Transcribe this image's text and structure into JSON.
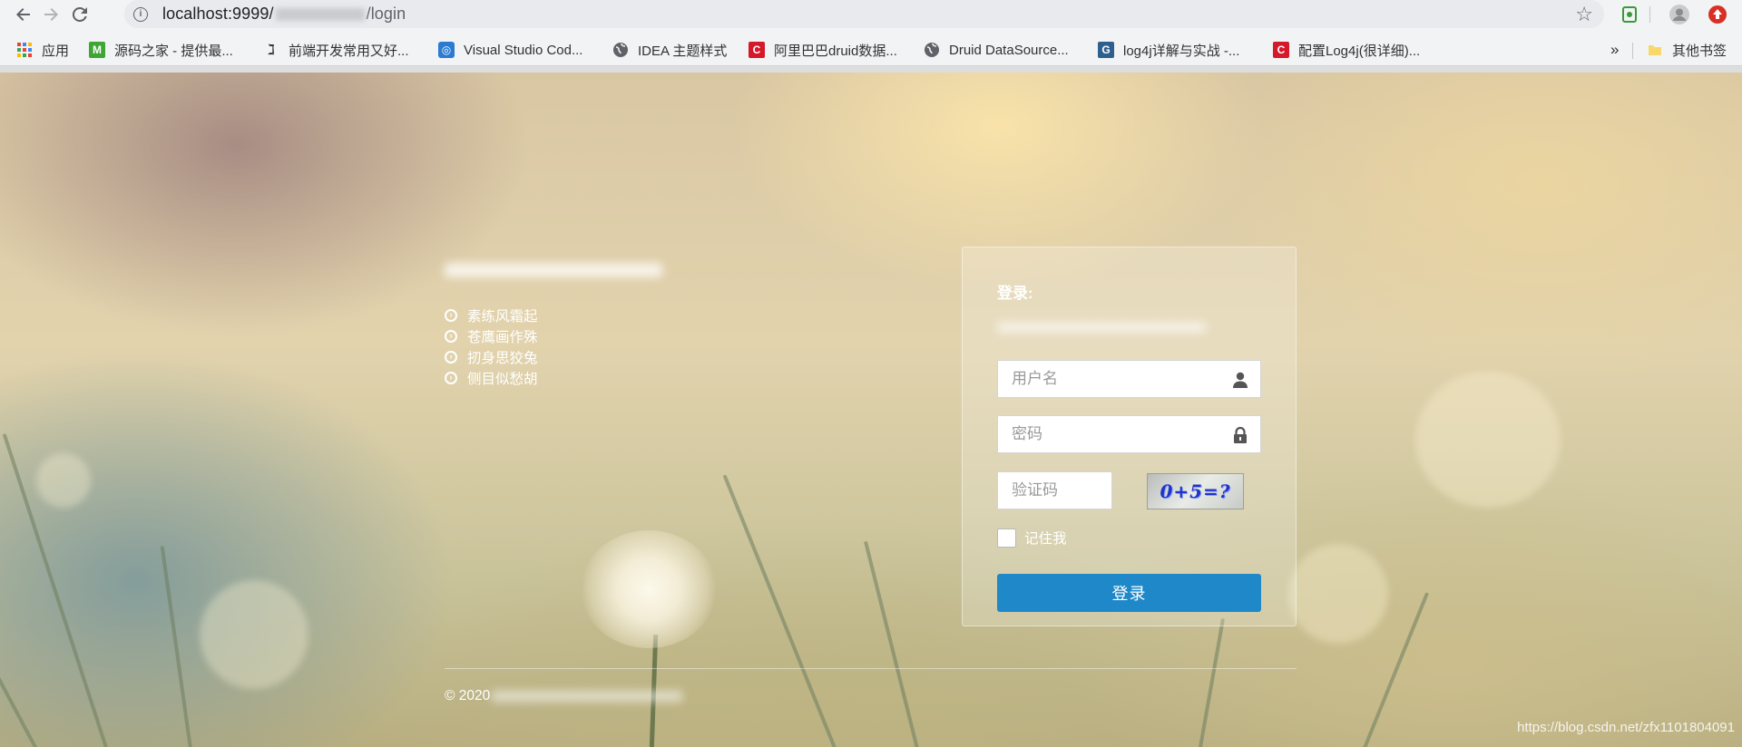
{
  "browser": {
    "url_host": "localhost:9999/",
    "url_path": "/login",
    "bookmarks": [
      {
        "label": "应用",
        "icon": "apps-grid-icon"
      },
      {
        "label": "源码之家 - 提供最...",
        "icon": "m-logo-icon"
      },
      {
        "label": "前端开发常用又好...",
        "icon": "a-logo-icon"
      },
      {
        "label": "Visual Studio Cod...",
        "icon": "vscode-icon"
      },
      {
        "label": "IDEA 主题样式",
        "icon": "globe-icon"
      },
      {
        "label": "阿里巴巴druid数据...",
        "icon": "csdn-icon"
      },
      {
        "label": "Druid DataSource...",
        "icon": "globe-icon"
      },
      {
        "label": "log4j详解与实战 -...",
        "icon": "cnblogs-icon"
      },
      {
        "label": "配置Log4j(很详细)...",
        "icon": "csdn-icon"
      }
    ],
    "more_bookmarks": "»",
    "other_bookmarks": "其他书签"
  },
  "page": {
    "features": [
      "素练风霜起",
      "苍鹰画作殊",
      "扨身思狡兔",
      "侧目似愁胡"
    ],
    "login": {
      "title": "登录:",
      "username_placeholder": "用户名",
      "password_placeholder": "密码",
      "captcha_placeholder": "验证码",
      "captcha_text": "0+5=?",
      "remember_label": "记住我",
      "submit_label": "登录"
    },
    "copyright_prefix": "© 2020",
    "watermark": "https://blog.csdn.net/zfx1101804091"
  },
  "colors": {
    "primary_button": "#1e88c9",
    "captcha_text": "#1f35c9"
  }
}
